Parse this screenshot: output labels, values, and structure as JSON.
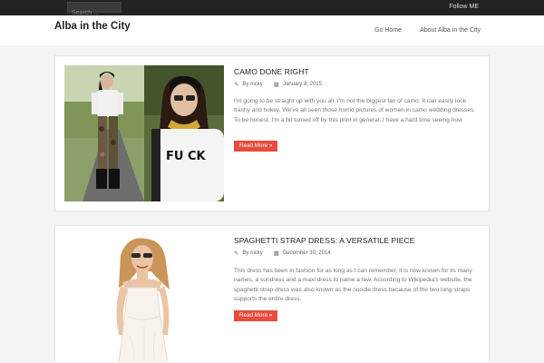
{
  "topbar": {
    "search_placeholder": "Search ...",
    "follow_label": "Follow ME"
  },
  "header": {
    "site_title": "Alba in the City",
    "nav": [
      "Go Home",
      "About Alba in the City"
    ]
  },
  "posts": [
    {
      "title": "CAMO DONE RIGHT",
      "author": "By nicky",
      "date": "January 8, 2015",
      "excerpt": "I'm going to be straight up with you all, I'm not the biggest fan of camo. It can easily look trashy and hokey. We've all seen those horrid pictures of women in camo wedding dresses. To be honest, I'm a bit turned off by this print in general. I have a hard time seeing how",
      "read_more": "Read More »",
      "shirt_text": "FU CK"
    },
    {
      "title": "SPAGHETTI STRAP DRESS: A VERSATILE PIECE",
      "author": "By nicky",
      "date": "December 30, 2014",
      "excerpt": "This dress has been in fashion for as long as I can remember, it is now known for its many names, a sundress and a maxi dress to name a few. According to Wikipedia's website, the spaghetti strap dress was also known as the noodle dress because of the two long straps supports the entire dress.",
      "read_more": "Read More »"
    }
  ],
  "icons": {
    "author": "pencil-icon",
    "date": "calendar-icon"
  },
  "colors": {
    "topbar": "#222222",
    "accent": "#e74c3c"
  }
}
